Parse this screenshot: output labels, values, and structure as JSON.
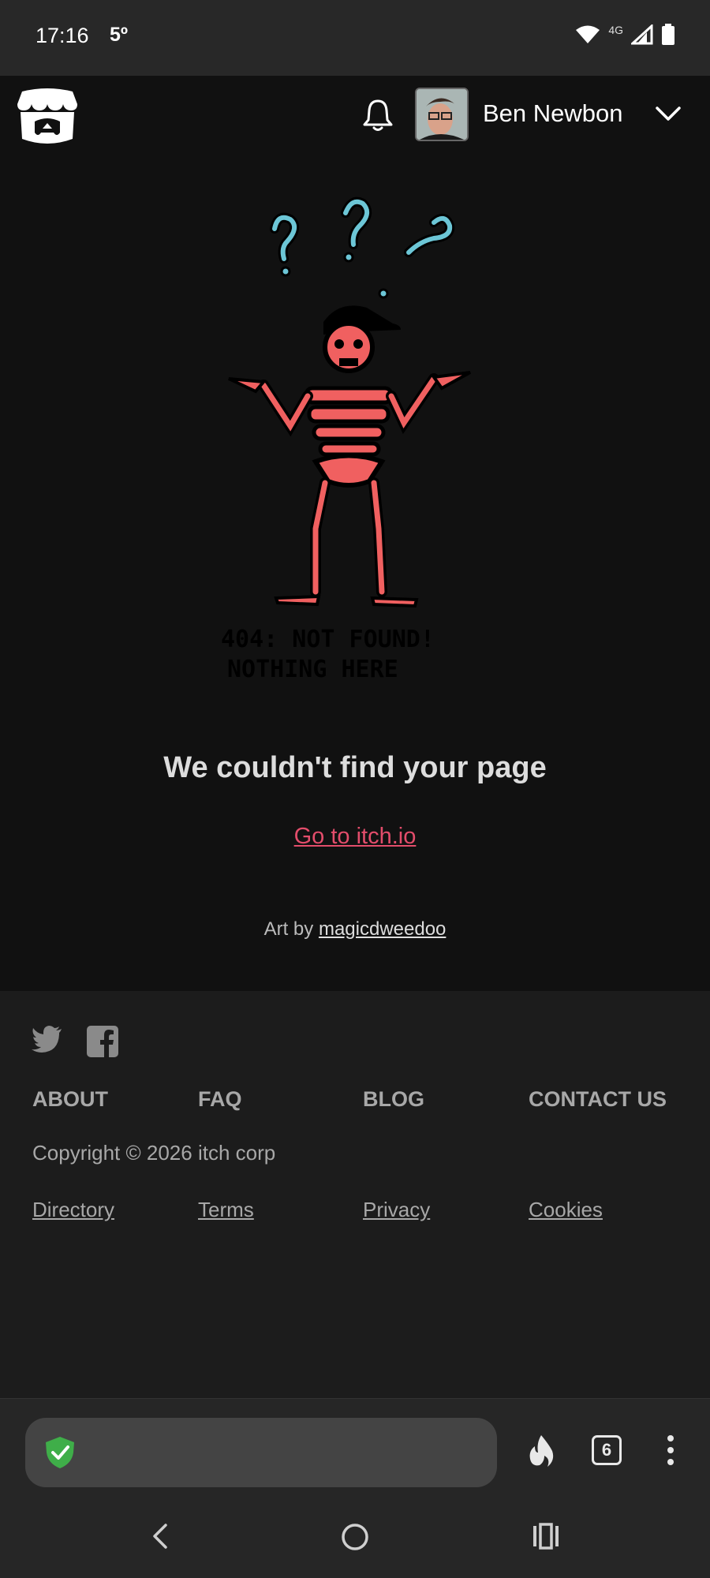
{
  "status_bar": {
    "time": "17:16",
    "temperature": "5º",
    "network_label": "4G"
  },
  "header": {
    "user_name": "Ben Newbon"
  },
  "main": {
    "art_text_line1": "404: NOT FOUND!",
    "art_text_line2": "NOTHING HERE",
    "headline": "We couldn't find your page",
    "home_link": "Go to itch.io",
    "credit_prefix": "Art by ",
    "credit_artist": "magicdweedoo"
  },
  "footer": {
    "links": [
      "ABOUT",
      "FAQ",
      "BLOG",
      "CONTACT US"
    ],
    "copyright": "Copyright © 2026 itch corp",
    "legal": [
      "Directory",
      "Terms",
      "Privacy",
      "Cookies"
    ],
    "social_icons": [
      "twitter-icon",
      "facebook-icon"
    ]
  },
  "browser": {
    "tab_count": "6",
    "icons": [
      "shield-check-icon",
      "flame-icon",
      "tabs-icon",
      "more-vertical-icon"
    ]
  },
  "colors": {
    "page_bg": "#111111",
    "footer_bg": "#1c1c1c",
    "link": "#e34d6b",
    "skeleton": "#f06060",
    "question_marks": "#6cc6d6"
  }
}
